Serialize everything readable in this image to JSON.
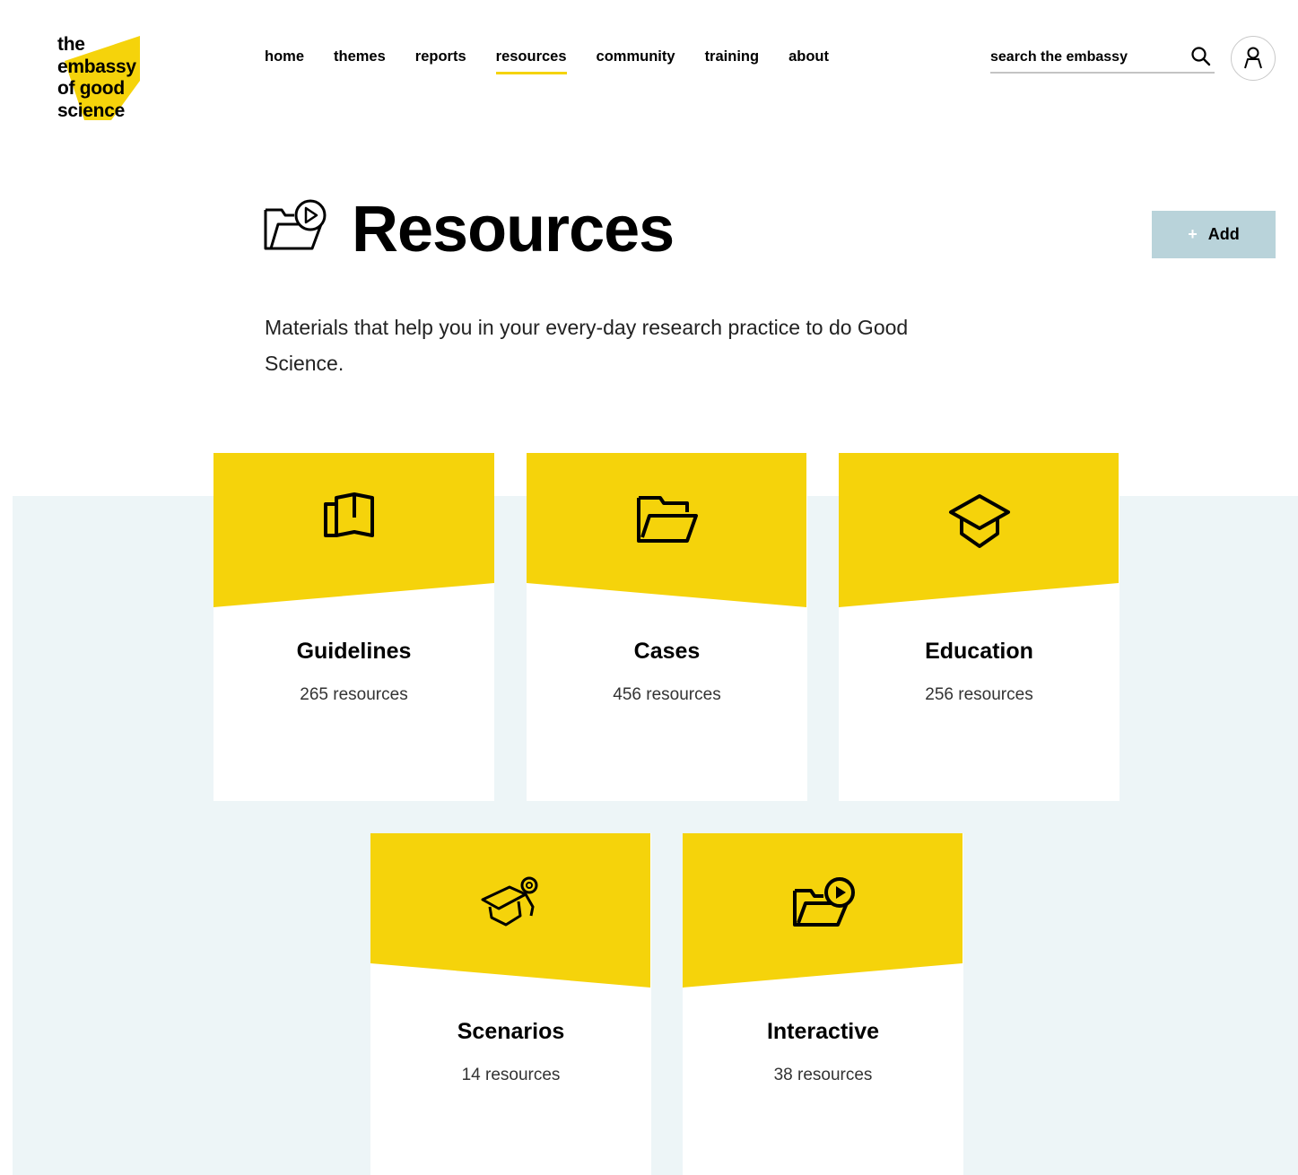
{
  "header": {
    "logo_lines": [
      "the",
      "embassy",
      "of good",
      "science"
    ],
    "nav": [
      {
        "label": "home"
      },
      {
        "label": "themes"
      },
      {
        "label": "reports"
      },
      {
        "label": "resources",
        "active": true
      },
      {
        "label": "community"
      },
      {
        "label": "training"
      },
      {
        "label": "about"
      }
    ],
    "search_placeholder": "search the embassy"
  },
  "page": {
    "title": "Resources",
    "add_label": "Add",
    "description": "Materials that help you in your every-day research practice to do Good Science."
  },
  "categories": [
    {
      "name": "Guidelines",
      "count": "265 resources",
      "icon": "open-book-icon"
    },
    {
      "name": "Cases",
      "count": "456 resources",
      "icon": "folder-icon"
    },
    {
      "name": "Education",
      "count": "256 resources",
      "icon": "graduation-cap-icon"
    },
    {
      "name": "Scenarios",
      "count": "14 resources",
      "icon": "graduation-cap-gear-icon"
    },
    {
      "name": "Interactive",
      "count": "38 resources",
      "icon": "folder-play-icon"
    }
  ],
  "colors": {
    "accent": "#f5d30b",
    "band": "#edf5f7",
    "add_button": "#b9d3da"
  }
}
